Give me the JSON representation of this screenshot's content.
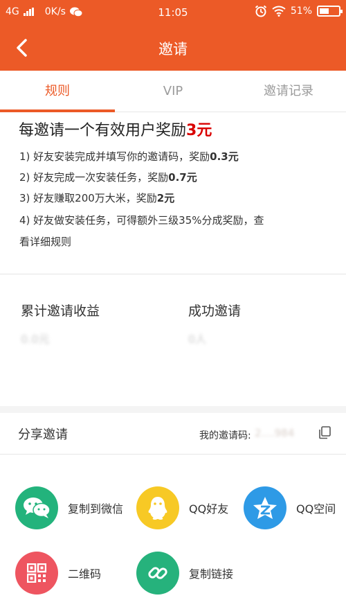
{
  "status_bar": {
    "network": "4G",
    "speed": "0K/s",
    "time": "11:05",
    "battery": "51%",
    "battery_level": 0.51
  },
  "nav": {
    "title": "邀请"
  },
  "tabs": [
    {
      "label": "规则",
      "active": true
    },
    {
      "label": "VIP",
      "active": false
    },
    {
      "label": "邀请记录",
      "active": false
    }
  ],
  "rules": {
    "headline_prefix": "每邀请一个有效用户奖励",
    "headline_amount": "3元",
    "items": [
      {
        "text": "1) 好友安装完成并填写你的邀请码，奖励",
        "bold": "0.3元"
      },
      {
        "text": "2) 好友完成一次安装任务，奖励",
        "bold": "0.7元"
      },
      {
        "text": "3) 好友赚取200万大米，奖励",
        "bold": "2元"
      },
      {
        "text": "4) 好友做安装任务，可得额外三级35%分成奖励，查",
        "bold": ""
      },
      {
        "text": "看详细规则",
        "bold": ""
      }
    ]
  },
  "stats": {
    "earnings_label": "累计邀请收益",
    "earnings_value": "0.0元",
    "invited_label": "成功邀请",
    "invited_value": "0人"
  },
  "share": {
    "title": "分享邀请",
    "code_label": "我的邀请码:",
    "code_value": "2....984",
    "items": [
      {
        "label": "复制到微信",
        "icon": "wechat-icon",
        "color": "#23b37c"
      },
      {
        "label": "QQ好友",
        "icon": "qq-icon",
        "color": "#f7c925"
      },
      {
        "label": "QQ空间",
        "icon": "qzone-icon",
        "color": "#2e9ae6"
      },
      {
        "label": "二维码",
        "icon": "qrcode-icon",
        "color": "#ee5560"
      },
      {
        "label": "复制链接",
        "icon": "link-icon",
        "color": "#26b27c"
      }
    ]
  },
  "colors": {
    "accent": "#ec5a27",
    "highlight": "#d90000"
  }
}
